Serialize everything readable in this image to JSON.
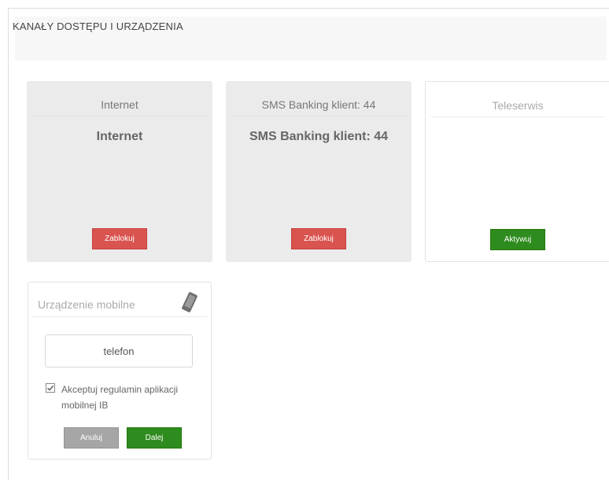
{
  "panel": {
    "title": "KANAŁY DOSTĘPU I URZĄDZENIA"
  },
  "cards": [
    {
      "subtitle": "Internet",
      "name": "Internet",
      "button_label": "Zablokuj",
      "button_color": "#d9534f",
      "background": "#ebebeb"
    },
    {
      "subtitle": "SMS Banking klient: 44",
      "name": "SMS Banking klient: 44",
      "button_label": "Zablokuj",
      "button_color": "#d9534f",
      "background": "#ebebeb"
    },
    {
      "subtitle": "Teleserwis",
      "name": "",
      "button_label": "Aktywuj",
      "button_color": "#2e8b1e",
      "background": "#ffffff"
    }
  ],
  "mobile": {
    "title": "Urządzenie mobilne",
    "icon": "phone-icon",
    "device_value": "telefon",
    "terms_checked": true,
    "terms_label": "Akceptuj regulamin aplikacji mobilnej IB",
    "cancel_label": "Anuluj",
    "next_label": "Dalej"
  }
}
